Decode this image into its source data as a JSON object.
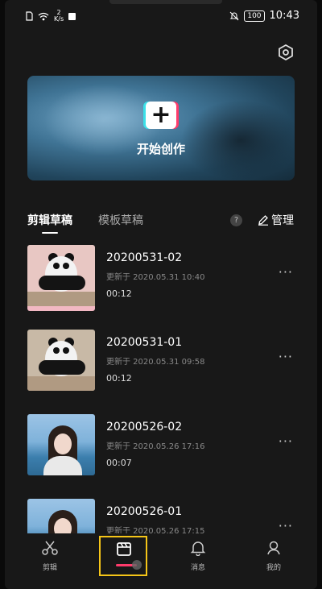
{
  "status_bar": {
    "network_speed_value": "2",
    "network_speed_unit": "K/s",
    "battery": "100",
    "time": "10:43"
  },
  "banner": {
    "plus_icon": "+",
    "label": "开始创作"
  },
  "tabs": {
    "drafts": "剪辑草稿",
    "templates": "模板草稿",
    "help_icon": "?",
    "manage": "管理"
  },
  "drafts": [
    {
      "title": "20200531-02",
      "updated": "更新于 2020.05.31 10:40",
      "duration": "00:12",
      "thumb": "panda"
    },
    {
      "title": "20200531-01",
      "updated": "更新于 2020.05.31 09:58",
      "duration": "00:12",
      "thumb": "panda"
    },
    {
      "title": "20200526-02",
      "updated": "更新于 2020.05.26 17:16",
      "duration": "00:07",
      "thumb": "girl"
    },
    {
      "title": "20200526-01",
      "updated": "更新于 2020.05.26 17:15",
      "duration": "",
      "thumb": "girl"
    }
  ],
  "more_icon": "···",
  "nav": {
    "edit": "剪辑",
    "messages": "消息",
    "me": "我的"
  },
  "colors": {
    "background": "#181818",
    "accent_pink": "#ff3b6b",
    "accent_cyan": "#3be0e8",
    "highlight": "#f5c518"
  }
}
